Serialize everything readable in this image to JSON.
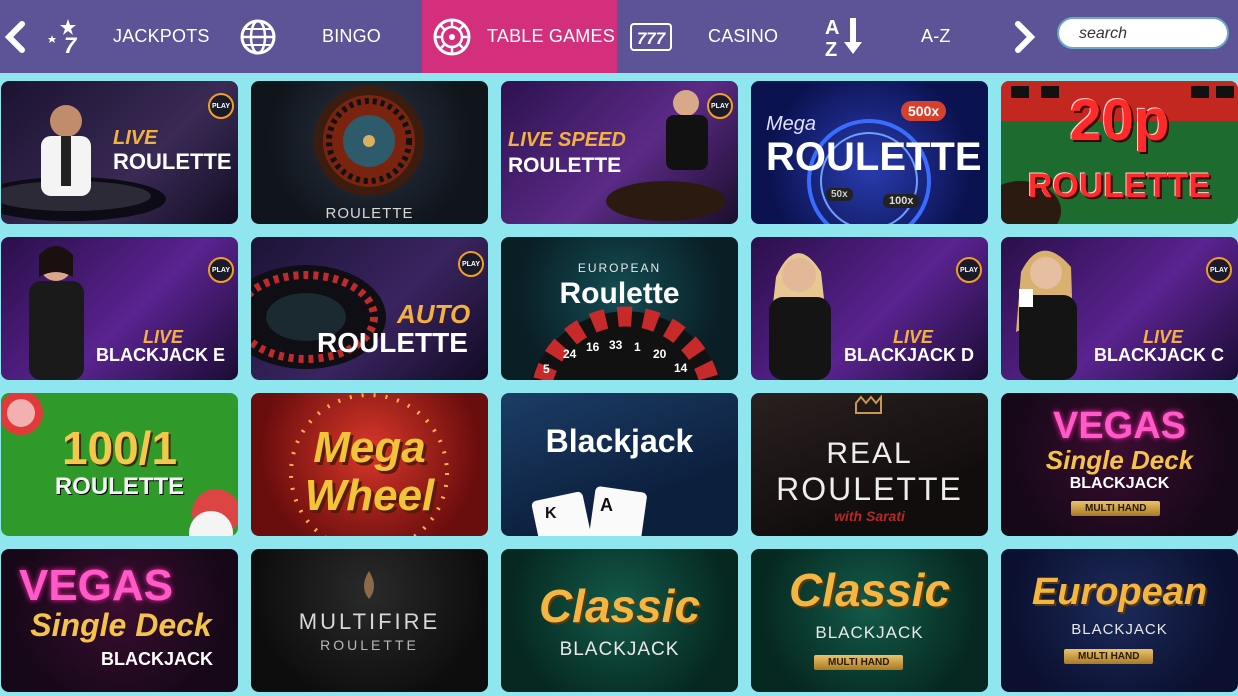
{
  "nav": {
    "prev_icon": "chevron-left-icon",
    "next_icon": "chevron-right-icon",
    "items": [
      {
        "label": "JACKPOTS",
        "icon": "star-7-icon"
      },
      {
        "label": "BINGO",
        "icon": "globe-icon"
      },
      {
        "label": "TABLE GAMES",
        "icon": "roulette-wheel-icon",
        "active": true
      },
      {
        "label": "CASINO",
        "icon": "slot-777-icon"
      },
      {
        "label": "A-Z",
        "icon": "sort-az-icon"
      }
    ],
    "icon_text": {
      "jackpots": "7",
      "casino": "777",
      "az_top": "A",
      "az_bottom": "Z"
    },
    "search_placeholder": "search",
    "colors": {
      "bar": "#5c5496",
      "active": "#d42f7d",
      "page_bg": "#8fe6ef"
    }
  },
  "games": [
    {
      "title": "LIVE ROULETTE",
      "line1": "LIVE",
      "line2": "ROULETTE",
      "badge": "PLAY"
    },
    {
      "title": "ROULETTE",
      "line1": "ROULETTE"
    },
    {
      "title": "LIVE SPEED ROULETTE",
      "line1": "LIVE SPEED",
      "line2": "ROULETTE",
      "badge": "PLAY"
    },
    {
      "title": "Mega ROULETTE",
      "line1": "Mega",
      "line2": "ROULETTE",
      "tag1": "500x",
      "tag2": "50x",
      "tag3": "100x"
    },
    {
      "title": "20p ROULETTE",
      "line1": "20p",
      "line2": "ROULETTE"
    },
    {
      "title": "LIVE BLACKJACK E",
      "line1": "LIVE",
      "line2": "BLACKJACK E",
      "badge": "PLAY"
    },
    {
      "title": "AUTO ROULETTE",
      "line1": "AUTO",
      "line2": "ROULETTE",
      "badge": "PLAY"
    },
    {
      "title": "EUROPEAN Roulette",
      "line1": "EUROPEAN",
      "line2": "Roulette",
      "wheel_numbers": [
        "5",
        "24",
        "16",
        "33",
        "1",
        "20",
        "14"
      ]
    },
    {
      "title": "LIVE BLACKJACK D",
      "line1": "LIVE",
      "line2": "BLACKJACK D",
      "badge": "PLAY"
    },
    {
      "title": "LIVE BLACKJACK C",
      "line1": "LIVE",
      "line2": "BLACKJACK C",
      "badge": "PLAY"
    },
    {
      "title": "100/1 ROULETTE",
      "line1": "100/1",
      "line2": "ROULETTE"
    },
    {
      "title": "Mega Wheel",
      "line1": "Mega",
      "line2": "Wheel"
    },
    {
      "title": "Blackjack",
      "line1": "Blackjack",
      "card1": "K",
      "card2": "A"
    },
    {
      "title": "REAL ROULETTE with Sarati",
      "line1": "REAL",
      "line2": "ROULETTE",
      "line3": "with Sarati"
    },
    {
      "title": "VEGAS Single Deck BLACKJACK MULTI HAND",
      "line1": "VEGAS",
      "line2": "Single Deck",
      "line3": "BLACKJACK",
      "line4": "MULTI HAND"
    },
    {
      "title": "VEGAS Single Deck BLACKJACK",
      "line1": "VEGAS",
      "line2": "Single Deck",
      "line3": "BLACKJACK"
    },
    {
      "title": "MULTIFIRE ROULETTE",
      "line1": "MULTIFIRE",
      "line2": "ROULETTE"
    },
    {
      "title": "Classic BLACKJACK",
      "line1": "Classic",
      "line2": "BLACKJACK"
    },
    {
      "title": "Classic BLACKJACK MULTI HAND",
      "line1": "Classic",
      "line2": "BLACKJACK",
      "line3": "MULTI HAND"
    },
    {
      "title": "European BLACKJACK MULTI HAND",
      "line1": "European",
      "line2": "BLACKJACK",
      "line3": "MULTI HAND"
    }
  ]
}
